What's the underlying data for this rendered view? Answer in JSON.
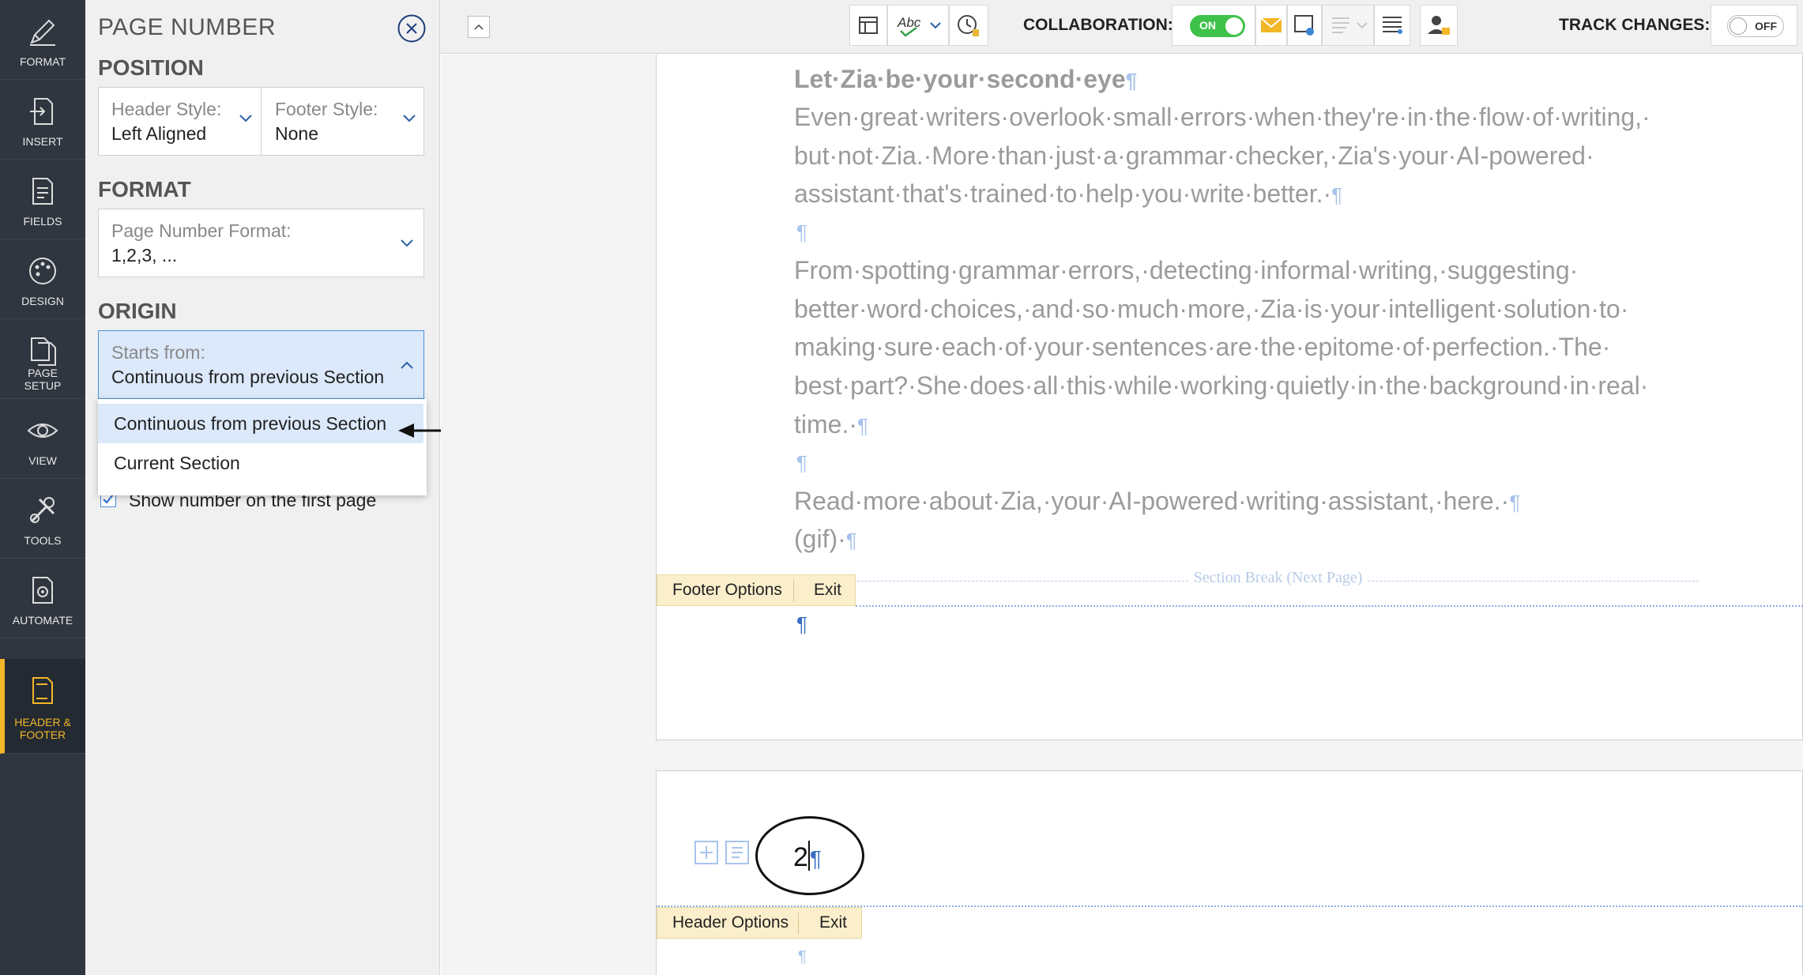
{
  "rail": {
    "items": [
      {
        "label": "FORMAT",
        "icon": "pen-icon"
      },
      {
        "label": "INSERT",
        "icon": "insert-icon"
      },
      {
        "label": "FIELDS",
        "icon": "fields-icon"
      },
      {
        "label": "DESIGN",
        "icon": "palette-icon"
      },
      {
        "label": "PAGE SETUP",
        "icon": "page-setup-icon"
      },
      {
        "label": "VIEW",
        "icon": "eye-icon"
      },
      {
        "label": "TOOLS",
        "icon": "tools-icon"
      },
      {
        "label": "AUTOMATE",
        "icon": "automate-icon"
      },
      {
        "label": "HEADER & FOOTER",
        "icon": "header-footer-icon"
      }
    ],
    "active_color": "#f2b627"
  },
  "panel": {
    "title": "PAGE NUMBER",
    "position_heading": "POSITION",
    "header_style_label": "Header Style:",
    "header_style_value": "Left Aligned",
    "footer_style_label": "Footer Style:",
    "footer_style_value": "None",
    "format_heading": "FORMAT",
    "page_number_format_label": "Page Number Format:",
    "page_number_format_value": "1,2,3, ...",
    "origin_heading": "ORIGIN",
    "starts_from_label": "Starts from:",
    "starts_from_value": "Continuous from previous Section",
    "dropdown_options": [
      "Continuous from previous Section",
      "Current Section"
    ],
    "show_first_page_label": "Show number on the first page",
    "show_first_page_checked": true
  },
  "toolbar": {
    "collaboration_label": "COLLABORATION:",
    "collaboration_toggle": "ON",
    "track_changes_label": "TRACK CHANGES:",
    "track_changes_toggle": "OFF",
    "spellcheck_text": "Abc",
    "on_color": "#3fc24a"
  },
  "document": {
    "heading": "Let·Zia·be·your·second·eye",
    "para1": [
      "Even·great·writers·overlook·small·errors·when·they're·in·the·flow·of·writing,·",
      "but·not·Zia.·More·than·just·a·grammar·checker,·Zia's·your·AI-powered·",
      "assistant·that's·trained·to·help·you·write·better.·"
    ],
    "para2": [
      "From·spotting·grammar·errors,·detecting·informal·writing,·suggesting·",
      "better·word·choices,·and·so·much·more,·Zia·is·your·intelligent·solution·to·",
      "making·sure·each·of·your·sentences·are·the·epitome·of·perfection.·The·",
      "best·part?·She·does·all·this·while·working·quietly·in·the·background·in·real·",
      "time.·"
    ],
    "para3": [
      "Read·more·about·Zia,·your·AI-powered·writing·assistant,·here.·",
      "(gif)·"
    ],
    "pilcrow": "¶",
    "section_break": "Section Break (Next Page)",
    "footer_options": "Footer Options",
    "header_options": "Header Options",
    "exit": "Exit",
    "page_number": "2"
  }
}
